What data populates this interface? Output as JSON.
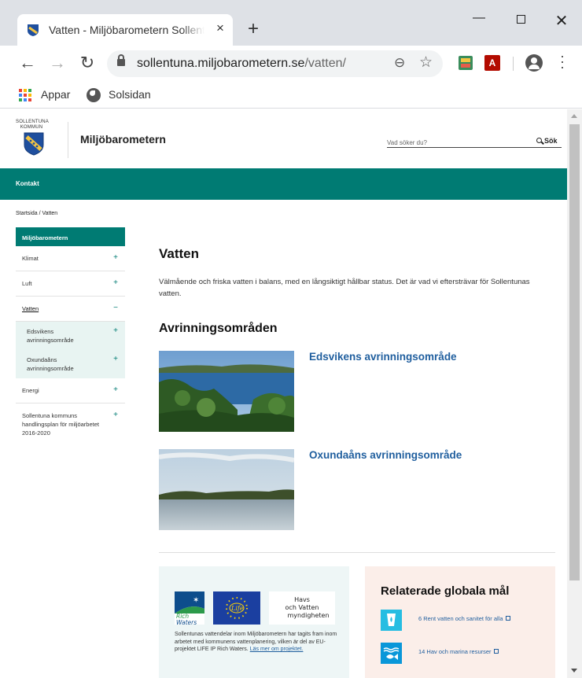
{
  "browser": {
    "tab_title": "Vatten - Miljöbarometern Sollentuna",
    "tab_close": "×",
    "new_tab": "+",
    "url_host": "sollentuna.miljobarometern.se",
    "url_path": "/vatten/",
    "window_minimize": "—",
    "window_close": "✕"
  },
  "bookmarks": [
    {
      "label": "Appar"
    },
    {
      "label": "Solsidan"
    }
  ],
  "site": {
    "municipality_line1": "SOLLENTUNA",
    "municipality_line2": "KOMMUN",
    "name": "Miljöbarometern",
    "search_placeholder": "Vad söker du?",
    "search_button": "Sök",
    "nav_contact": "Kontakt"
  },
  "breadcrumb": "Startsida / Vatten",
  "sidebar": {
    "title": "Miljöbarometern",
    "items": [
      {
        "label": "Klimat",
        "toggle": "+"
      },
      {
        "label": "Luft",
        "toggle": "+"
      },
      {
        "label": "Vatten",
        "toggle": "−"
      },
      {
        "label": "Energi",
        "toggle": "+"
      },
      {
        "label": "Sollentuna kommuns handlingsplan för miljöarbetet 2016-2020",
        "toggle": "+"
      }
    ],
    "subitems": [
      {
        "label": "Edsvikens avrinningsområde",
        "toggle": "+"
      },
      {
        "label": "Oxundaåns avrinningsområde",
        "toggle": "+"
      }
    ]
  },
  "main": {
    "title": "Vatten",
    "intro": "Välmående och friska vatten i balans, med en långsiktigt hållbar status. Det är vad vi eftersträvar för Sollentunas vatten.",
    "subtitle": "Avrinningsområden",
    "areas": [
      {
        "label": "Edsvikens avrinningsområde"
      },
      {
        "label": "Oxundaåns avrinningsområde"
      }
    ]
  },
  "rich_waters": {
    "logo_rich": "Rich",
    "logo_waters": "Waters",
    "logo_life": "Life",
    "logo_hav_1": "Havs",
    "logo_hav_2": "och Vatten",
    "logo_hav_3": "myndigheten",
    "text": "Sollentunas vattendelar inom Miljöbarometern har tagits fram inom arbetet med kommunens vattenplanering, vilken är del av EU-projektet LIFE IP Rich Waters.",
    "link": "Läs mer om projektet."
  },
  "goals": {
    "title": "Relaterade globala mål",
    "items": [
      {
        "label": "6 Rent vatten och sanitet för alla",
        "color": "#26bde2"
      },
      {
        "label": "14 Hav och marina resurser",
        "color": "#0a97d9"
      }
    ]
  },
  "colors": {
    "teal": "#007b73",
    "link_blue": "#1f5e9e"
  }
}
